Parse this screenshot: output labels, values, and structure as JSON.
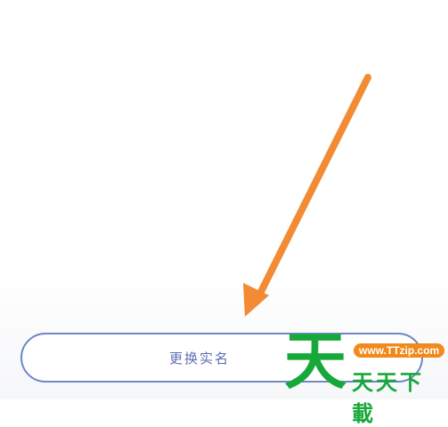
{
  "button": {
    "label": "更换实名"
  },
  "watermark": {
    "logo_char": "天",
    "url": "www.TTzip.com",
    "name": "天天下載"
  },
  "annotation": {
    "arrow_color": "#f28b33",
    "icon": "arrow-down-left-icon"
  },
  "colors": {
    "button_border": "#6f86c7",
    "button_text": "#5d6fb2",
    "watermark_green": "#17a83a",
    "watermark_orange": "#f08a1c"
  }
}
